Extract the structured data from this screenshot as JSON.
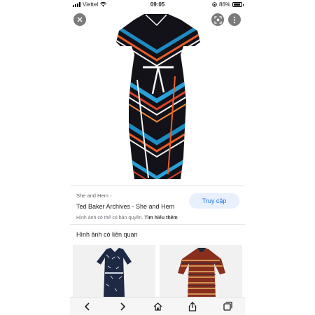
{
  "status_bar": {
    "carrier": "Viettel",
    "time": "09:05",
    "battery": "86%",
    "battery_level": 0.86
  },
  "viewer": {
    "icons": [
      "close-icon",
      "lens-icon",
      "more-vert-icon"
    ]
  },
  "result": {
    "site_name": "She and Hem -",
    "title": "Ted Baker Archives - She and Hem",
    "visit_label": "Truy cập",
    "copyright_text": "Hình ảnh có thể có bản quyền.",
    "learn_more": "Tìm hiểu thêm"
  },
  "related": {
    "heading": "Hình ảnh có liên quan"
  },
  "toolbar": {
    "icons": [
      "back-icon",
      "forward-icon",
      "home-icon",
      "share-icon",
      "tabs-icon"
    ]
  },
  "colors": {
    "accent": "#1a73e8",
    "button_bg": "#e8f0fe",
    "overlay_button": "#7b7b7b"
  }
}
